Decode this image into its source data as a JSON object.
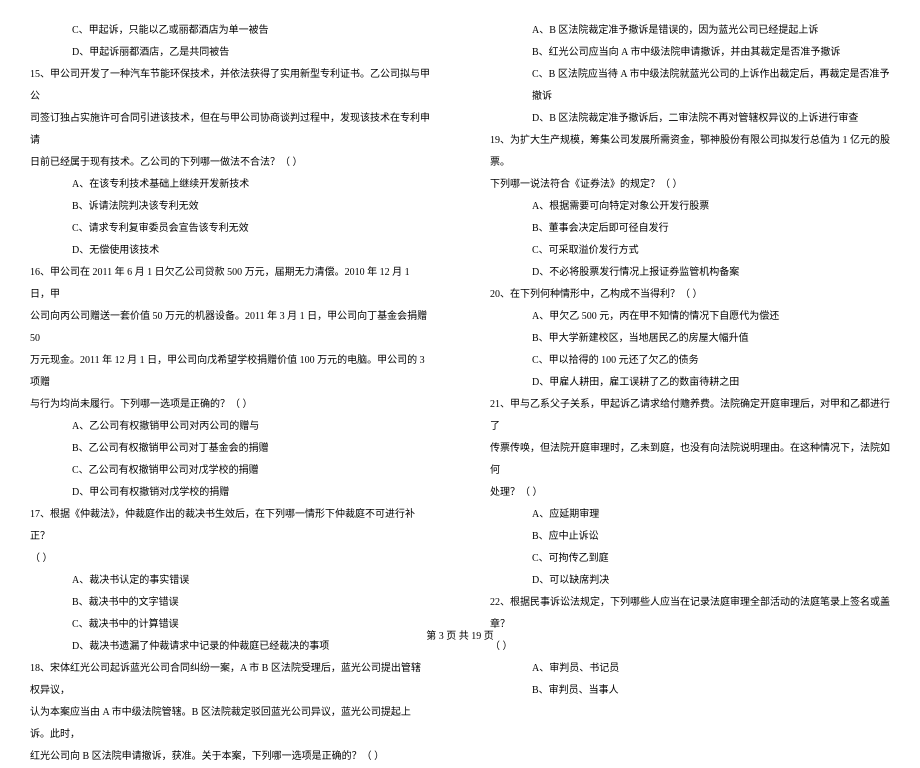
{
  "left_column": {
    "lines": [
      {
        "type": "option",
        "text": "C、甲起诉，只能以乙或丽都酒店为单一被告"
      },
      {
        "type": "option",
        "text": "D、甲起诉丽都酒店，乙是共同被告"
      },
      {
        "type": "question",
        "text": "15、甲公司开发了一种汽车节能环保技术，并依法获得了实用新型专利证书。乙公司拟与甲公"
      },
      {
        "type": "continuation",
        "text": "司签订独占实施许可合同引进该技术，但在与甲公司协商谈判过程中，发现该技术在专利申请"
      },
      {
        "type": "continuation",
        "text": "日前已经属于现有技术。乙公司的下列哪一做法不合法？（     ）"
      },
      {
        "type": "option",
        "text": "A、在该专利技术基础上继续开发新技术"
      },
      {
        "type": "option",
        "text": "B、诉请法院判决该专利无效"
      },
      {
        "type": "option",
        "text": "C、请求专利复审委员会宣告该专利无效"
      },
      {
        "type": "option",
        "text": "D、无偿使用该技术"
      },
      {
        "type": "question",
        "text": "16、甲公司在 2011 年 6 月 1 日欠乙公司贷款 500 万元，届期无力清偿。2010 年 12 月 1 日，甲"
      },
      {
        "type": "continuation",
        "text": "公司向丙公司赠送一套价值 50 万元的机器设备。2011 年 3 月 1 日，甲公司向丁基金会捐赠 50"
      },
      {
        "type": "continuation",
        "text": "万元现金。2011 年 12 月 1 日，甲公司向戊希望学校捐赠价值 100 万元的电脑。甲公司的 3 项赠"
      },
      {
        "type": "continuation",
        "text": "与行为均尚未履行。下列哪一选项是正确的？（     ）"
      },
      {
        "type": "option",
        "text": "A、乙公司有权撤销甲公司对丙公司的赠与"
      },
      {
        "type": "option",
        "text": "B、乙公司有权撤销甲公司对丁基金会的捐赠"
      },
      {
        "type": "option",
        "text": "C、乙公司有权撤销甲公司对戊学校的捐赠"
      },
      {
        "type": "option",
        "text": "D、甲公司有权撤销对戊学校的捐赠"
      },
      {
        "type": "question",
        "text": "17、根据《仲裁法》，仲裁庭作出的裁决书生效后，在下列哪一情形下仲裁庭不可进行补正？"
      },
      {
        "type": "standalone-paren",
        "text": "（     ）"
      },
      {
        "type": "option",
        "text": "A、裁决书认定的事实错误"
      },
      {
        "type": "option",
        "text": "B、裁决书中的文字错误"
      },
      {
        "type": "option",
        "text": "C、裁决书中的计算错误"
      },
      {
        "type": "option",
        "text": "D、裁决书遗漏了仲裁请求中记录的仲裁庭已经裁决的事项"
      },
      {
        "type": "question",
        "text": "18、宋体红光公司起诉蓝光公司合同纠纷一案，A 市 B 区法院受理后，蓝光公司提出管辖权异议，"
      },
      {
        "type": "continuation",
        "text": "认为本案应当由 A 市中级法院管辖。B 区法院裁定驳回蓝光公司异议，蓝光公司提起上诉。此时，"
      },
      {
        "type": "continuation",
        "text": "红光公司向 B 区法院申请撤诉，获准。关于本案，下列哪一选项是正确的？（     ）"
      }
    ]
  },
  "right_column": {
    "lines": [
      {
        "type": "option",
        "text": "A、B 区法院裁定准予撤诉是错误的，因为蓝光公司已经提起上诉"
      },
      {
        "type": "option",
        "text": "B、红光公司应当向 A 市中级法院申请撤诉，并由其裁定是否准予撤诉"
      },
      {
        "type": "option",
        "text": "C、B 区法院应当待 A 市中级法院就蓝光公司的上诉作出裁定后，再裁定是否准予撤诉"
      },
      {
        "type": "option",
        "text": "D、B 区法院裁定准予撤诉后，二审法院不再对管辖权异议的上诉进行审查"
      },
      {
        "type": "question",
        "text": "19、为扩大生产规模，筹集公司发展所需资金，鄂神股份有限公司拟发行总值为 1 亿元的股票。"
      },
      {
        "type": "continuation",
        "text": "下列哪一说法符合《证券法》的规定？（     ）"
      },
      {
        "type": "option",
        "text": "A、根据需要可向特定对象公开发行股票"
      },
      {
        "type": "option",
        "text": "B、董事会决定后即可径自发行"
      },
      {
        "type": "option",
        "text": "C、可采取溢价发行方式"
      },
      {
        "type": "option",
        "text": "D、不必将股票发行情况上报证券监管机构备案"
      },
      {
        "type": "question",
        "text": "20、在下列何种情形中，乙构成不当得利？（     ）"
      },
      {
        "type": "option",
        "text": "A、甲欠乙 500 元，丙在甲不知情的情况下自愿代为偿还"
      },
      {
        "type": "option",
        "text": "B、甲大学新建校区，当地居民乙的房屋大幅升值"
      },
      {
        "type": "option",
        "text": "C、甲以拾得的 100 元还了欠乙的债务"
      },
      {
        "type": "option",
        "text": "D、甲雇人耕田，雇工误耕了乙的数亩待耕之田"
      },
      {
        "type": "question",
        "text": "21、甲与乙系父子关系，甲起诉乙请求给付赡养费。法院确定开庭审理后，对甲和乙都进行了"
      },
      {
        "type": "continuation",
        "text": "传票传唤，但法院开庭审理时，乙未到庭，也没有向法院说明理由。在这种情况下，法院如何"
      },
      {
        "type": "continuation",
        "text": "处理？（     ）"
      },
      {
        "type": "option",
        "text": "A、应延期审理"
      },
      {
        "type": "option",
        "text": "B、应中止诉讼"
      },
      {
        "type": "option",
        "text": "C、可拘传乙到庭"
      },
      {
        "type": "option",
        "text": "D、可以缺席判决"
      },
      {
        "type": "question",
        "text": "22、根据民事诉讼法规定，下列哪些人应当在记录法庭审理全部活动的法庭笔录上签名或盖章？"
      },
      {
        "type": "standalone-paren",
        "text": "（     ）"
      },
      {
        "type": "option",
        "text": "A、审判员、书记员"
      },
      {
        "type": "option",
        "text": "B、审判员、当事人"
      }
    ]
  },
  "footer": {
    "text": "第 3 页 共 19 页"
  }
}
